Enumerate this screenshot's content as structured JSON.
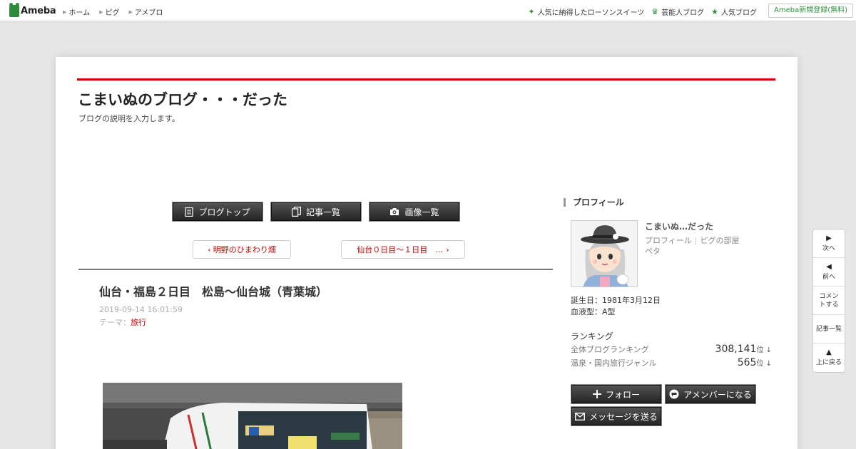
{
  "topbar": {
    "logo": "Ameba",
    "nav": [
      "ホーム",
      "ピグ",
      "アメブロ"
    ],
    "right_links": [
      {
        "icon": "sparkle-icon",
        "label": "人気に納得したローソンスイーツ"
      },
      {
        "icon": "crown-icon",
        "label": "芸能人ブログ"
      },
      {
        "icon": "star-icon",
        "label": "人気ブログ"
      }
    ],
    "register": "Ameba新規登録(無料)"
  },
  "blog": {
    "title": "こまいぬのブログ・・・だった",
    "description": "ブログの説明を入力します。"
  },
  "nav_buttons": [
    {
      "icon": "document-icon",
      "label": "ブログトップ"
    },
    {
      "icon": "copy-icon",
      "label": "記事一覧"
    },
    {
      "icon": "camera-icon",
      "label": "画像一覧"
    }
  ],
  "pager": {
    "prev": "明野のひまわり畑",
    "next": "仙台０日目～１日目　…"
  },
  "entry": {
    "title": "仙台・福島２日目　松島～仙台城（青葉城）",
    "date": "2019-09-14 16:01:59",
    "theme_label": "テーマ：",
    "theme": "旅行"
  },
  "sidebar": {
    "heading": "プロフィール",
    "name": "こまいぬ…だった",
    "link_profile": "プロフィール",
    "link_pig": "ピグの部屋",
    "peta": "ペタ",
    "birthday": "誕生日：1981年3月12日",
    "blood": "血液型：A型",
    "ranking_heading": "ランキング",
    "rankings": [
      {
        "label": "全体ブログランキング",
        "value": "308,141",
        "unit": "位 ↓"
      },
      {
        "label": "温泉・国内旅行ジャンル",
        "value": "565",
        "unit": "位 ↓"
      }
    ],
    "follow": "フォロー",
    "amember": "アメンバーになる",
    "message": "メッセージを送る"
  },
  "float_nav": {
    "next": "次へ",
    "prev": "前へ",
    "comment": "コメントする",
    "list": "記事一覧",
    "top": "上に戻る"
  },
  "colors": {
    "accent_red": "#cc0000",
    "ameba_green": "#2d8c3c"
  }
}
